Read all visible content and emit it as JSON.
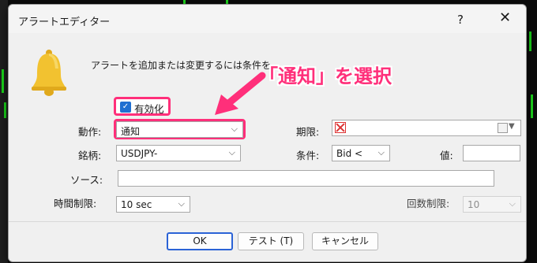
{
  "window": {
    "title": "アラートエディター",
    "help": "?",
    "close": "✕"
  },
  "description": "アラートを追加または変更するには条件を",
  "enable": {
    "label": "有効化",
    "checked": true
  },
  "action": {
    "label": "動作:",
    "value": "通知"
  },
  "symbol": {
    "label": "銘柄:",
    "value": "USDJPY-"
  },
  "source": {
    "label": "ソース:",
    "value": ""
  },
  "timeout": {
    "label": "時間制限:",
    "value": "10 sec"
  },
  "expiration": {
    "label": "期限:"
  },
  "condition": {
    "label": "条件:",
    "value": "Bid <"
  },
  "value": {
    "label": "値:",
    "value": ""
  },
  "max_iterations": {
    "label": "回数制限:",
    "value": "10"
  },
  "buttons": {
    "ok": "OK",
    "test": "テスト (T)",
    "cancel": "キャンセル"
  },
  "annotation": {
    "text": "「通知」を選択"
  },
  "colors": {
    "highlight": "#ff2f7a",
    "checkbox": "#1f6fd1",
    "primary_button_border": "#2b63d6",
    "bell": "#f2c230",
    "chart_green": "#1bd41b"
  },
  "icons": {
    "bell": "bell-icon",
    "close": "close-icon",
    "help": "help-icon",
    "dropdown": "chevron-down-icon"
  }
}
